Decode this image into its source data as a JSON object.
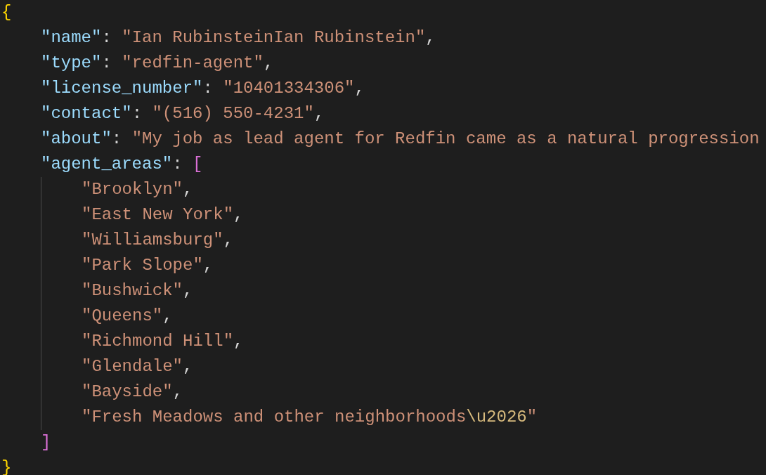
{
  "editor": {
    "lines": [
      {
        "tokens": [
          {
            "kind": "brace",
            "text": "{"
          }
        ],
        "children": [
          {
            "tokens": [
              {
                "kind": "key",
                "text": "\"name\""
              },
              {
                "kind": "punct",
                "text": ": "
              },
              {
                "kind": "string",
                "text": "\"Ian RubinsteinIan Rubinstein\""
              },
              {
                "kind": "punct",
                "text": ","
              }
            ]
          },
          {
            "tokens": [
              {
                "kind": "key",
                "text": "\"type\""
              },
              {
                "kind": "punct",
                "text": ": "
              },
              {
                "kind": "string",
                "text": "\"redfin-agent\""
              },
              {
                "kind": "punct",
                "text": ","
              }
            ]
          },
          {
            "tokens": [
              {
                "kind": "key",
                "text": "\"license_number\""
              },
              {
                "kind": "punct",
                "text": ": "
              },
              {
                "kind": "string",
                "text": "\"10401334306\""
              },
              {
                "kind": "punct",
                "text": ","
              }
            ]
          },
          {
            "tokens": [
              {
                "kind": "key",
                "text": "\"contact\""
              },
              {
                "kind": "punct",
                "text": ": "
              },
              {
                "kind": "string",
                "text": "\"(516) 550-4231\""
              },
              {
                "kind": "punct",
                "text": ","
              }
            ]
          },
          {
            "tokens": [
              {
                "kind": "key",
                "text": "\"about\""
              },
              {
                "kind": "punct",
                "text": ": "
              },
              {
                "kind": "string",
                "text": "\"My job as lead agent for Redfin came as a natural progression"
              }
            ]
          },
          {
            "tokens": [
              {
                "kind": "key",
                "text": "\"agent_areas\""
              },
              {
                "kind": "punct",
                "text": ": "
              },
              {
                "kind": "bracket",
                "text": "["
              }
            ],
            "children": [
              {
                "tokens": [
                  {
                    "kind": "string",
                    "text": "\"Brooklyn\""
                  },
                  {
                    "kind": "punct",
                    "text": ","
                  }
                ]
              },
              {
                "tokens": [
                  {
                    "kind": "string",
                    "text": "\"East New York\""
                  },
                  {
                    "kind": "punct",
                    "text": ","
                  }
                ]
              },
              {
                "tokens": [
                  {
                    "kind": "string",
                    "text": "\"Williamsburg\""
                  },
                  {
                    "kind": "punct",
                    "text": ","
                  }
                ]
              },
              {
                "tokens": [
                  {
                    "kind": "string",
                    "text": "\"Park Slope\""
                  },
                  {
                    "kind": "punct",
                    "text": ","
                  }
                ]
              },
              {
                "tokens": [
                  {
                    "kind": "string",
                    "text": "\"Bushwick\""
                  },
                  {
                    "kind": "punct",
                    "text": ","
                  }
                ]
              },
              {
                "tokens": [
                  {
                    "kind": "string",
                    "text": "\"Queens\""
                  },
                  {
                    "kind": "punct",
                    "text": ","
                  }
                ]
              },
              {
                "tokens": [
                  {
                    "kind": "string",
                    "text": "\"Richmond Hill\""
                  },
                  {
                    "kind": "punct",
                    "text": ","
                  }
                ]
              },
              {
                "tokens": [
                  {
                    "kind": "string",
                    "text": "\"Glendale\""
                  },
                  {
                    "kind": "punct",
                    "text": ","
                  }
                ]
              },
              {
                "tokens": [
                  {
                    "kind": "string",
                    "text": "\"Bayside\""
                  },
                  {
                    "kind": "punct",
                    "text": ","
                  }
                ]
              },
              {
                "tokens": [
                  {
                    "kind": "string",
                    "text": "\"Fresh Meadows and other neighborhoods"
                  },
                  {
                    "kind": "escape",
                    "text": "\\u2026"
                  },
                  {
                    "kind": "string",
                    "text": "\""
                  }
                ]
              }
            ]
          },
          {
            "tokens": [
              {
                "kind": "bracket",
                "text": "]"
              }
            ]
          }
        ]
      },
      {
        "tokens": [
          {
            "kind": "brace",
            "text": "}"
          }
        ]
      }
    ]
  }
}
